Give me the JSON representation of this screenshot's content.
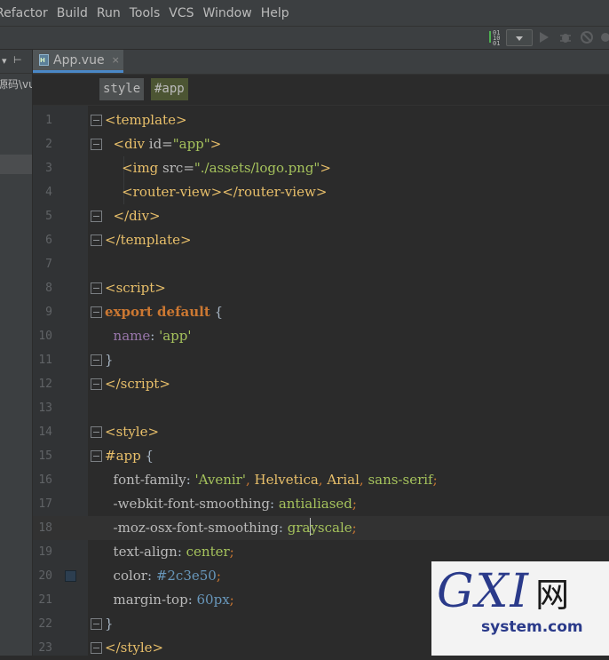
{
  "menubar": {
    "items": [
      "Refactor",
      "Build",
      "Run",
      "Tools",
      "VCS",
      "Window",
      "Help"
    ]
  },
  "toolbar": {
    "binary_label": "01\n10\n01",
    "icons": [
      "run-config-dropdown",
      "run-icon",
      "debug-icon",
      "coverage-icon",
      "profile-icon"
    ]
  },
  "project_panel": {
    "path_fragment": "源码\\vu"
  },
  "tabs": [
    {
      "label": "App.vue",
      "close": "×"
    }
  ],
  "breadcrumb": [
    "style",
    "#app"
  ],
  "editor": {
    "line_numbers": [
      "1",
      "2",
      "3",
      "4",
      "5",
      "6",
      "7",
      "8",
      "9",
      "10",
      "11",
      "12",
      "13",
      "14",
      "15",
      "16",
      "17",
      "18",
      "19",
      "20",
      "21",
      "22",
      "23"
    ],
    "colors": {
      "tag": "#e8bf6a",
      "string": "#a5c25c",
      "keyword": "#cc7832",
      "property": "#9876aa",
      "number": "#6897bb",
      "swatch": "#2c3e50"
    }
  },
  "watermark": {
    "logo": "GXI",
    "net": "网",
    "domain": "system.com"
  }
}
